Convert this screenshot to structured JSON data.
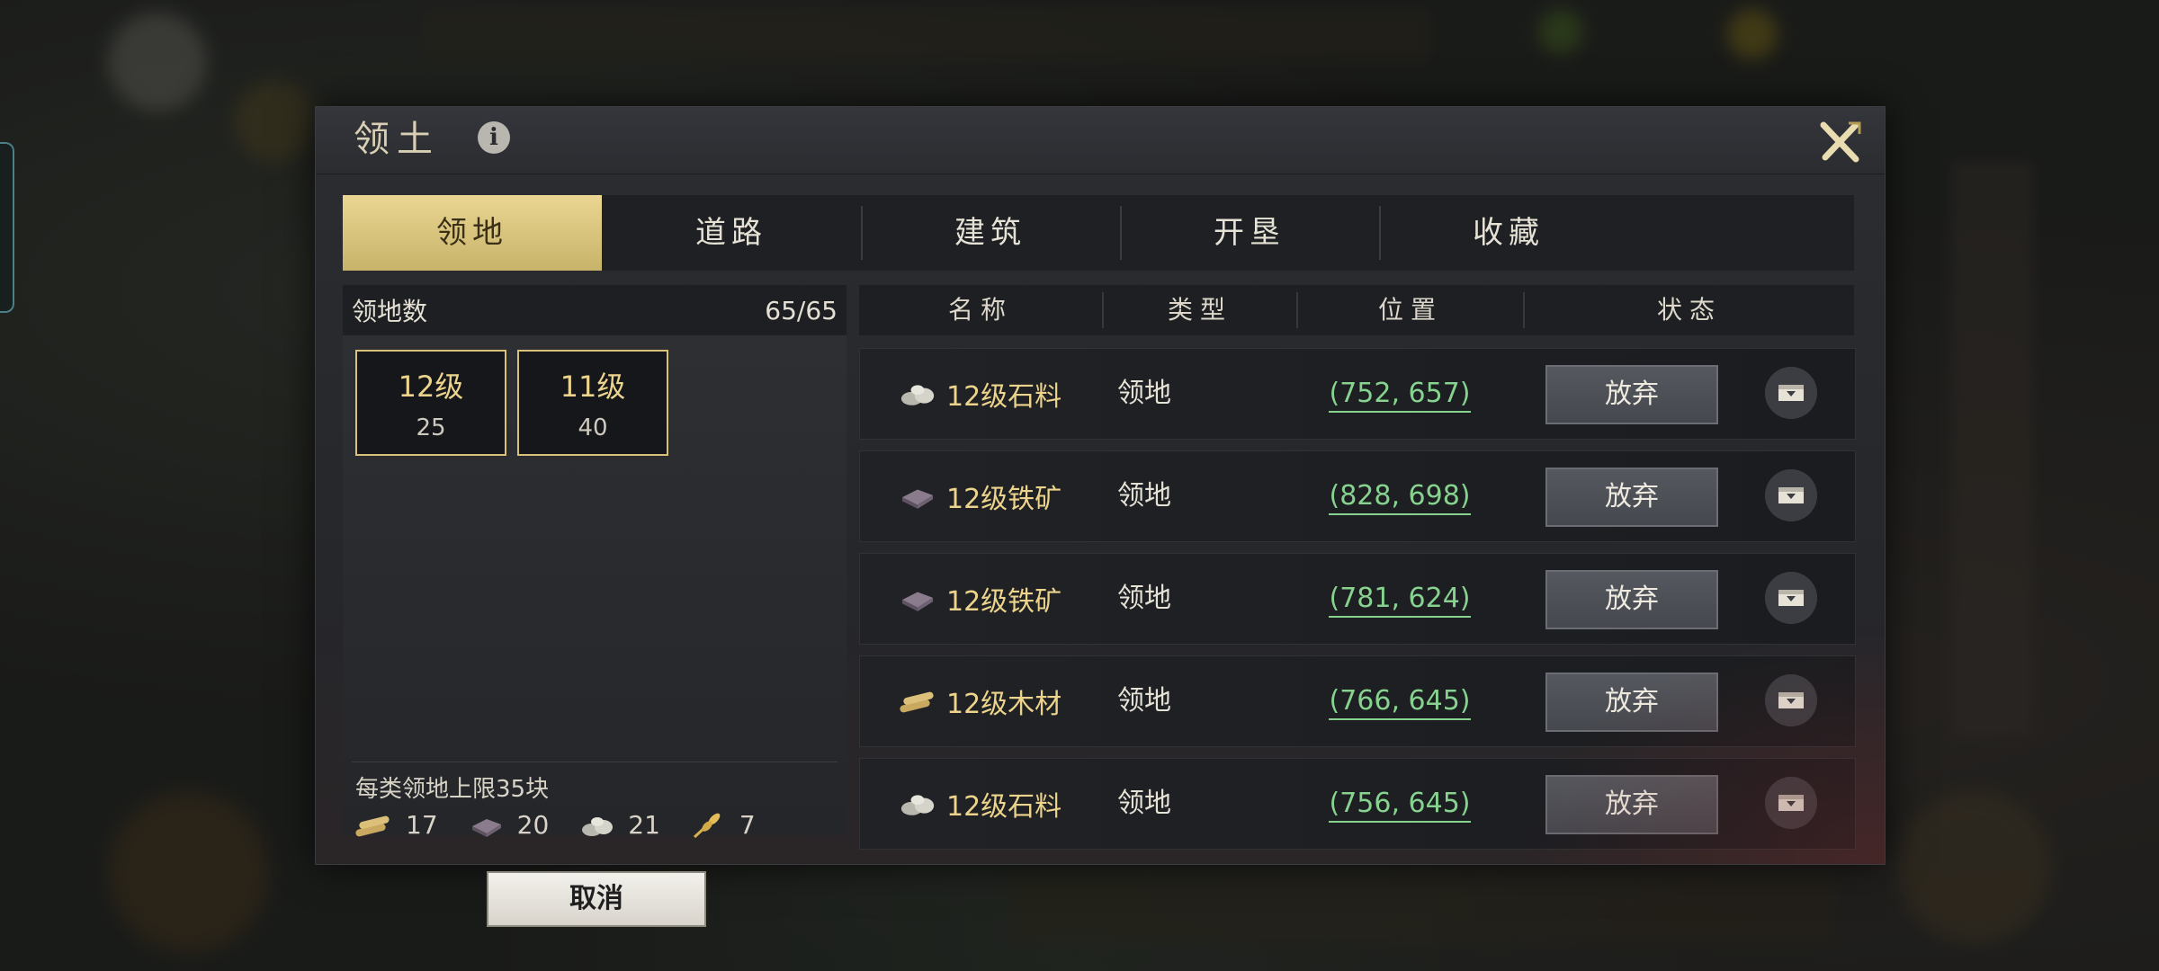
{
  "dialog": {
    "title": "领土",
    "info_icon": "info-icon",
    "close_icon": "close-x-icon"
  },
  "tabs": [
    {
      "label": "领地",
      "active": true
    },
    {
      "label": "道路",
      "active": false
    },
    {
      "label": "建筑",
      "active": false
    },
    {
      "label": "开垦",
      "active": false
    },
    {
      "label": "收藏",
      "active": false
    }
  ],
  "summary": {
    "label": "领地数",
    "count": "65/65",
    "levels": [
      {
        "level": "12级",
        "count": "25"
      },
      {
        "level": "11级",
        "count": "40"
      }
    ],
    "limit_text": "每类领地上限35块",
    "resource_counts": [
      {
        "icon": "wood-icon",
        "value": "17"
      },
      {
        "icon": "iron-icon",
        "value": "20"
      },
      {
        "icon": "stone-icon",
        "value": "21"
      },
      {
        "icon": "grain-icon",
        "value": "7"
      }
    ],
    "cancel_label": "取消"
  },
  "table": {
    "headers": [
      "名称",
      "类型",
      "位置",
      "状态"
    ],
    "rows": [
      {
        "icon": "stone-icon",
        "name": "12级石料",
        "type": "领地",
        "position": "(752, 657)",
        "action": "放弃"
      },
      {
        "icon": "iron-icon",
        "name": "12级铁矿",
        "type": "领地",
        "position": "(828, 698)",
        "action": "放弃"
      },
      {
        "icon": "iron-icon",
        "name": "12级铁矿",
        "type": "领地",
        "position": "(781, 624)",
        "action": "放弃"
      },
      {
        "icon": "wood-icon",
        "name": "12级木材",
        "type": "领地",
        "position": "(766, 645)",
        "action": "放弃"
      },
      {
        "icon": "stone-icon",
        "name": "12级石料",
        "type": "领地",
        "position": "(756, 645)",
        "action": "放弃"
      }
    ]
  },
  "colors": {
    "accent_gold": "#ecd48c",
    "coordinate_green": "#86d28e",
    "active_tab": "#e3cd85"
  }
}
